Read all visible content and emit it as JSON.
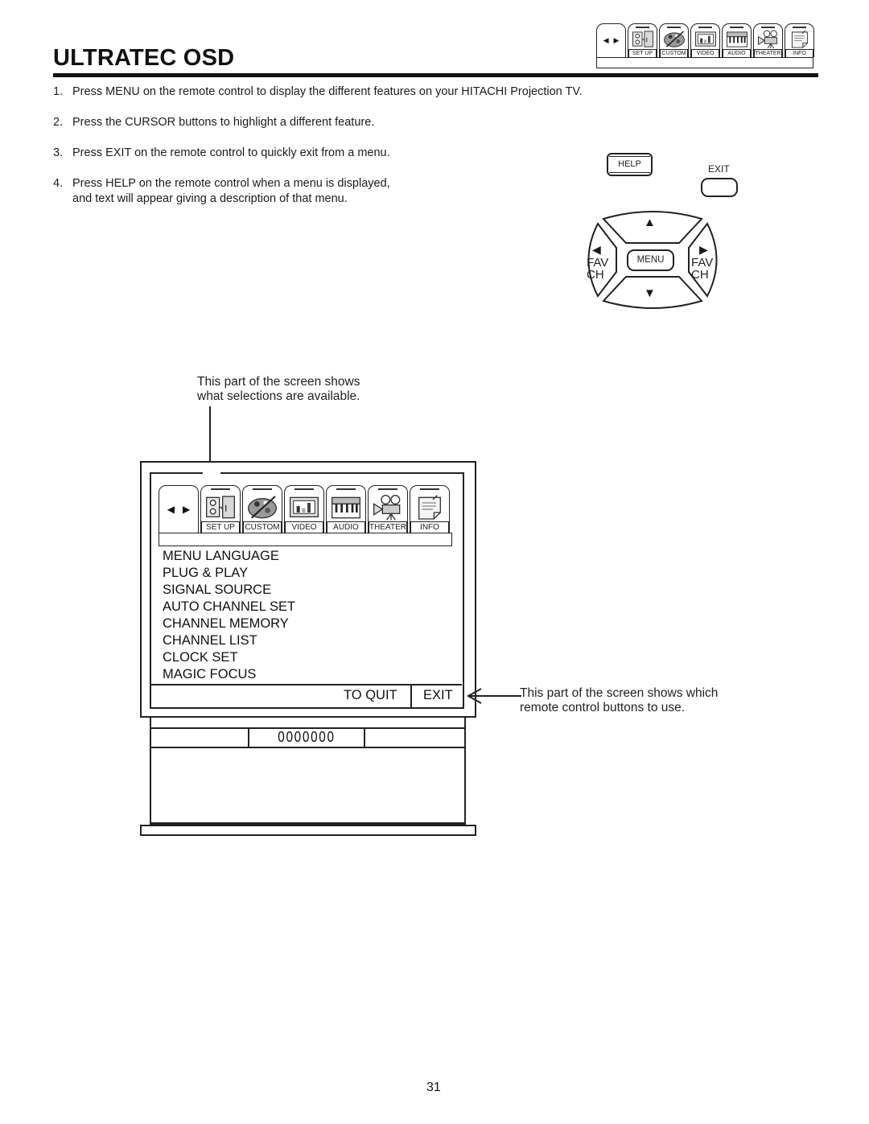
{
  "page": {
    "title": "ULTRATEC OSD",
    "page_number": "31"
  },
  "menu_tabs": [
    {
      "id": "nav",
      "label": "",
      "icon": "left-right-arrows-icon"
    },
    {
      "id": "setup",
      "label": "SET UP",
      "icon": "power-outlet-icon"
    },
    {
      "id": "custom",
      "label": "CUSTOM",
      "icon": "paint-palette-icon"
    },
    {
      "id": "video",
      "label": "VIDEO",
      "icon": "bar-chart-screen-icon"
    },
    {
      "id": "audio",
      "label": "AUDIO",
      "icon": "keyboard-piano-icon"
    },
    {
      "id": "theater",
      "label": "THEATER",
      "icon": "film-projector-icon"
    },
    {
      "id": "info",
      "label": "INFO",
      "icon": "note-page-icon"
    }
  ],
  "nav_arrows": {
    "left": "◀",
    "right": "▶"
  },
  "instructions": [
    {
      "num": "1.",
      "text": "Press MENU on the remote control to display the different features on your HITACHI Projection TV."
    },
    {
      "num": "2.",
      "text": "Press the CURSOR buttons to highlight a different feature."
    },
    {
      "num": "3.",
      "text": "Press EXIT on the remote control to quickly exit from a menu."
    },
    {
      "num": "4.",
      "text": "Press HELP on the remote control when a menu is displayed,",
      "cont": "and text will appear giving a description of that menu."
    }
  ],
  "remote": {
    "help": "HELP",
    "exit": "EXIT",
    "menu": "MENU",
    "up_arrow": "▲",
    "down_arrow": "▼",
    "left_arrow": "◀",
    "right_arrow": "▶",
    "fav": "FAV",
    "ch": "CH"
  },
  "callouts": {
    "top_line1": "This part of the screen shows",
    "top_line2": "what selections are available.",
    "right_line1": "This part of the screen shows which",
    "right_line2": "remote control buttons to use."
  },
  "osd": {
    "menu_items": [
      "MENU LANGUAGE",
      "PLUG & PLAY",
      "SIGNAL SOURCE",
      "AUTO CHANNEL SET",
      "CHANNEL MEMORY",
      "CHANNEL LIST",
      "CLOCK SET",
      "MAGIC FOCUS"
    ],
    "to_quit": "TO QUIT",
    "exit": "EXIT"
  },
  "tv_panel": {
    "digits": "0000000"
  }
}
